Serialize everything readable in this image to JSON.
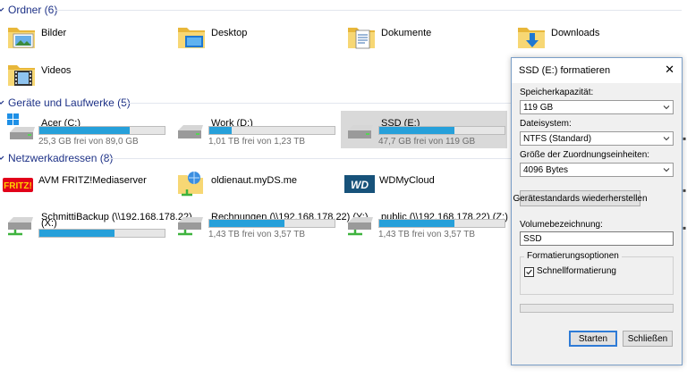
{
  "groups": {
    "ordner": "Ordner (6)",
    "geraete": "Geräte und Laufwerke (5)",
    "netz": "Netzwerkadressen (8)"
  },
  "folders": [
    {
      "name": "Bilder",
      "icon": "pictures-folder-icon"
    },
    {
      "name": "Desktop",
      "icon": "desktop-folder-icon"
    },
    {
      "name": "Dokumente",
      "icon": "documents-folder-icon"
    },
    {
      "name": "Downloads",
      "icon": "downloads-folder-icon"
    },
    {
      "name": "Videos",
      "icon": "videos-folder-icon"
    }
  ],
  "drives": [
    {
      "name": "Acer (C:)",
      "free": "25,3 GB frei von 89,0 GB",
      "used_fraction": 0.72,
      "icon": "windows-drive-icon"
    },
    {
      "name": "Work (D:)",
      "free": "1,01 TB frei von 1,23 TB",
      "used_fraction": 0.18,
      "icon": "hard-drive-icon"
    },
    {
      "name": "SSD (E:)",
      "free": "47,7 GB frei von 119 GB",
      "used_fraction": 0.6,
      "icon": "hard-drive-icon"
    }
  ],
  "network": [
    {
      "name": "AVM FRITZ!Mediaserver",
      "icon": "fritz-logo-icon"
    },
    {
      "name": "oldienaut.myDS.me",
      "icon": "network-globe-icon"
    },
    {
      "name": "WDMyCloud",
      "icon": "wd-logo-icon"
    }
  ],
  "network_drives": [
    {
      "name": "SchmittiBackup (\\\\192.168.178.22)",
      "name2": "(X:)",
      "free": "",
      "used_fraction": 0.6,
      "icon": "network-drive-icon"
    },
    {
      "name": "Rechnungen (\\\\192.168.178.22) (Y:)",
      "name2": "",
      "free": "1,43 TB frei von 3,57 TB",
      "used_fraction": 0.6,
      "icon": "network-drive-icon"
    },
    {
      "name": "public (\\\\192.168.178.22) (Z:)",
      "name2": "",
      "free": "1,43 TB frei von 3,57 TB",
      "used_fraction": 0.6,
      "icon": "network-drive-icon"
    }
  ],
  "dialog": {
    "title": "SSD (E:) formatieren",
    "close": "✕",
    "capacity_label": "Speicherkapazität:",
    "capacity_value": "119 GB",
    "fs_label": "Dateisystem:",
    "fs_value": "NTFS (Standard)",
    "alloc_label": "Größe der Zuordnungseinheiten:",
    "alloc_value": "4096 Bytes",
    "restore_label": "Gerätestandards wiederherstellen",
    "volume_label": "Volumebezeichnung:",
    "volume_value": "SSD",
    "options_label": "Formatierungsoptionen",
    "quick_label": "Schnellformatierung",
    "quick_checked": true,
    "start_label": "Starten",
    "close_label": "Schließen"
  },
  "colors": {
    "bar_fill": "#26a0da",
    "group_title": "#1e3287",
    "selection": "#d9d9d9"
  }
}
